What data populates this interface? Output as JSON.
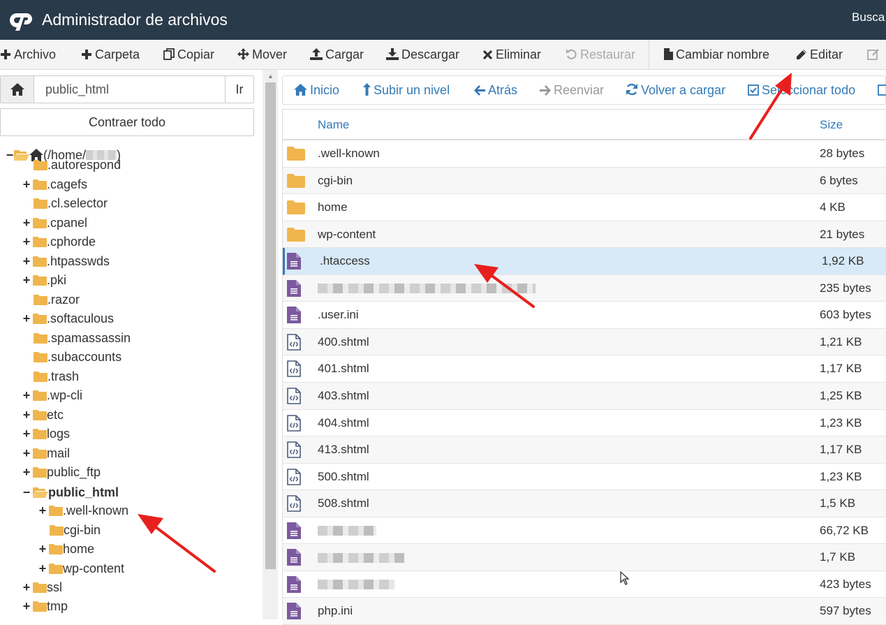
{
  "header": {
    "title": "Administrador de archivos",
    "search_label": "Busca"
  },
  "toolbar": {
    "archivo": "Archivo",
    "carpeta": "Carpeta",
    "copiar": "Copiar",
    "mover": "Mover",
    "cargar": "Cargar",
    "descargar": "Descargar",
    "eliminar": "Eliminar",
    "restaurar": "Restaurar",
    "cambiar_nombre": "Cambiar nombre",
    "editar": "Editar"
  },
  "left": {
    "path_value": "public_html",
    "go_label": "Ir",
    "collapse_label": "Contraer todo",
    "root_label": "(/home/",
    "root_suffix": ")",
    "tree": [
      {
        "label": ".autorespond"
      },
      {
        "label": ".cagefs"
      },
      {
        "label": ".cl.selector"
      },
      {
        "label": ".cpanel"
      },
      {
        "label": ".cphorde"
      },
      {
        "label": ".htpasswds"
      },
      {
        "label": ".pki"
      },
      {
        "label": ".razor"
      },
      {
        "label": ".softaculous"
      },
      {
        "label": ".spamassassin"
      },
      {
        "label": ".subaccounts"
      },
      {
        "label": ".trash"
      },
      {
        "label": ".wp-cli"
      },
      {
        "label": "etc"
      },
      {
        "label": "logs"
      },
      {
        "label": "mail"
      },
      {
        "label": "public_ftp"
      },
      {
        "label": "public_html"
      },
      {
        "label": ".well-known"
      },
      {
        "label": "cgi-bin"
      },
      {
        "label": "home"
      },
      {
        "label": "wp-content"
      },
      {
        "label": "ssl"
      },
      {
        "label": "tmp"
      }
    ]
  },
  "nav": {
    "inicio": "Inicio",
    "subir": "Subir un nivel",
    "atras": "Atrás",
    "reenviar": "Reenviar",
    "recargar": "Volver a cargar",
    "seleccionar": "Seleccionar todo"
  },
  "table": {
    "col_name": "Name",
    "col_size": "Size",
    "rows": [
      {
        "name": ".well-known",
        "size": "28 bytes"
      },
      {
        "name": "cgi-bin",
        "size": "6 bytes"
      },
      {
        "name": "home",
        "size": "4 KB"
      },
      {
        "name": "wp-content",
        "size": "21 bytes"
      },
      {
        "name": ".htaccess",
        "size": "1,92 KB"
      },
      {
        "name": "",
        "size": "235 bytes"
      },
      {
        "name": ".user.ini",
        "size": "603 bytes"
      },
      {
        "name": "400.shtml",
        "size": "1,21 KB"
      },
      {
        "name": "401.shtml",
        "size": "1,17 KB"
      },
      {
        "name": "403.shtml",
        "size": "1,25 KB"
      },
      {
        "name": "404.shtml",
        "size": "1,23 KB"
      },
      {
        "name": "413.shtml",
        "size": "1,17 KB"
      },
      {
        "name": "500.shtml",
        "size": "1,23 KB"
      },
      {
        "name": "508.shtml",
        "size": "1,5 KB"
      },
      {
        "name": "",
        "size": "66,72 KB"
      },
      {
        "name": "",
        "size": "1,7 KB"
      },
      {
        "name": "",
        "size": "423 bytes"
      },
      {
        "name": "php.ini",
        "size": "597 bytes"
      }
    ]
  }
}
